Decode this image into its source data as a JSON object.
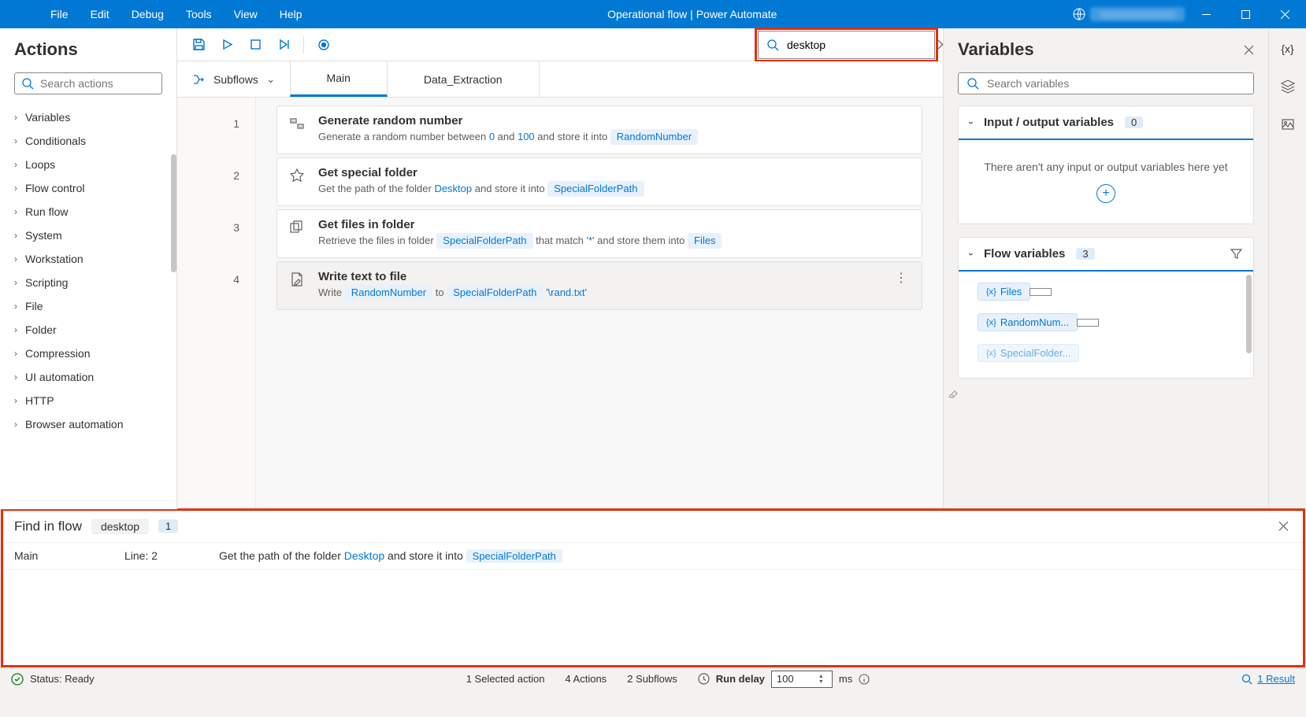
{
  "title": "Operational flow | Power Automate",
  "menu": [
    "File",
    "Edit",
    "Debug",
    "Tools",
    "View",
    "Help"
  ],
  "actions": {
    "header": "Actions",
    "search_placeholder": "Search actions",
    "categories": [
      "Variables",
      "Conditionals",
      "Loops",
      "Flow control",
      "Run flow",
      "System",
      "Workstation",
      "Scripting",
      "File",
      "Folder",
      "Compression",
      "UI automation",
      "HTTP",
      "Browser automation"
    ]
  },
  "toolbar": {
    "search_value": "desktop"
  },
  "subflows_label": "Subflows",
  "tabs": [
    {
      "label": "Main",
      "active": true
    },
    {
      "label": "Data_Extraction",
      "active": false
    }
  ],
  "steps": [
    {
      "num": "1",
      "title": "Generate random number",
      "desc_pre": "Generate a random number between ",
      "v1": "0",
      "mid1": " and ",
      "v2": "100",
      "mid2": " and store it into ",
      "chip": "RandomNumber"
    },
    {
      "num": "2",
      "title": "Get special folder",
      "desc_pre": "Get the path of the folder ",
      "v1": "Desktop",
      "mid2": " and store it into ",
      "chip": "SpecialFolderPath"
    },
    {
      "num": "3",
      "title": "Get files in folder",
      "desc_pre": "Retrieve the files in folder ",
      "chip1": "SpecialFolderPath",
      "mid1": " that match '",
      "v1": "*",
      "mid2": "' and store them into ",
      "chip": "Files"
    },
    {
      "num": "4",
      "title": "Write text to file",
      "desc_pre": "Write ",
      "chip1": "RandomNumber",
      "mid1": " to ",
      "chip2": "SpecialFolderPath",
      "v1": "'\\rand.txt'",
      "selected": true
    }
  ],
  "variables": {
    "header": "Variables",
    "search_placeholder": "Search variables",
    "io_label": "Input / output variables",
    "io_count": "0",
    "io_empty": "There aren't any input or output variables here yet",
    "flow_label": "Flow variables",
    "flow_count": "3",
    "flow_vars": [
      "Files",
      "RandomNum...",
      "SpecialFolder..."
    ]
  },
  "find": {
    "title": "Find in flow",
    "term": "desktop",
    "count": "1",
    "row": {
      "subflow": "Main",
      "line": "Line: 2",
      "desc_pre": "Get the path of the folder ",
      "v1": "Desktop",
      "mid": " and store it into ",
      "chip": "SpecialFolderPath"
    }
  },
  "status": {
    "ready": "Status: Ready",
    "selected": "1 Selected action",
    "actions": "4 Actions",
    "subflows": "2 Subflows",
    "delay_label": "Run delay",
    "delay_value": "100",
    "delay_unit": "ms",
    "result": "1 Result"
  }
}
